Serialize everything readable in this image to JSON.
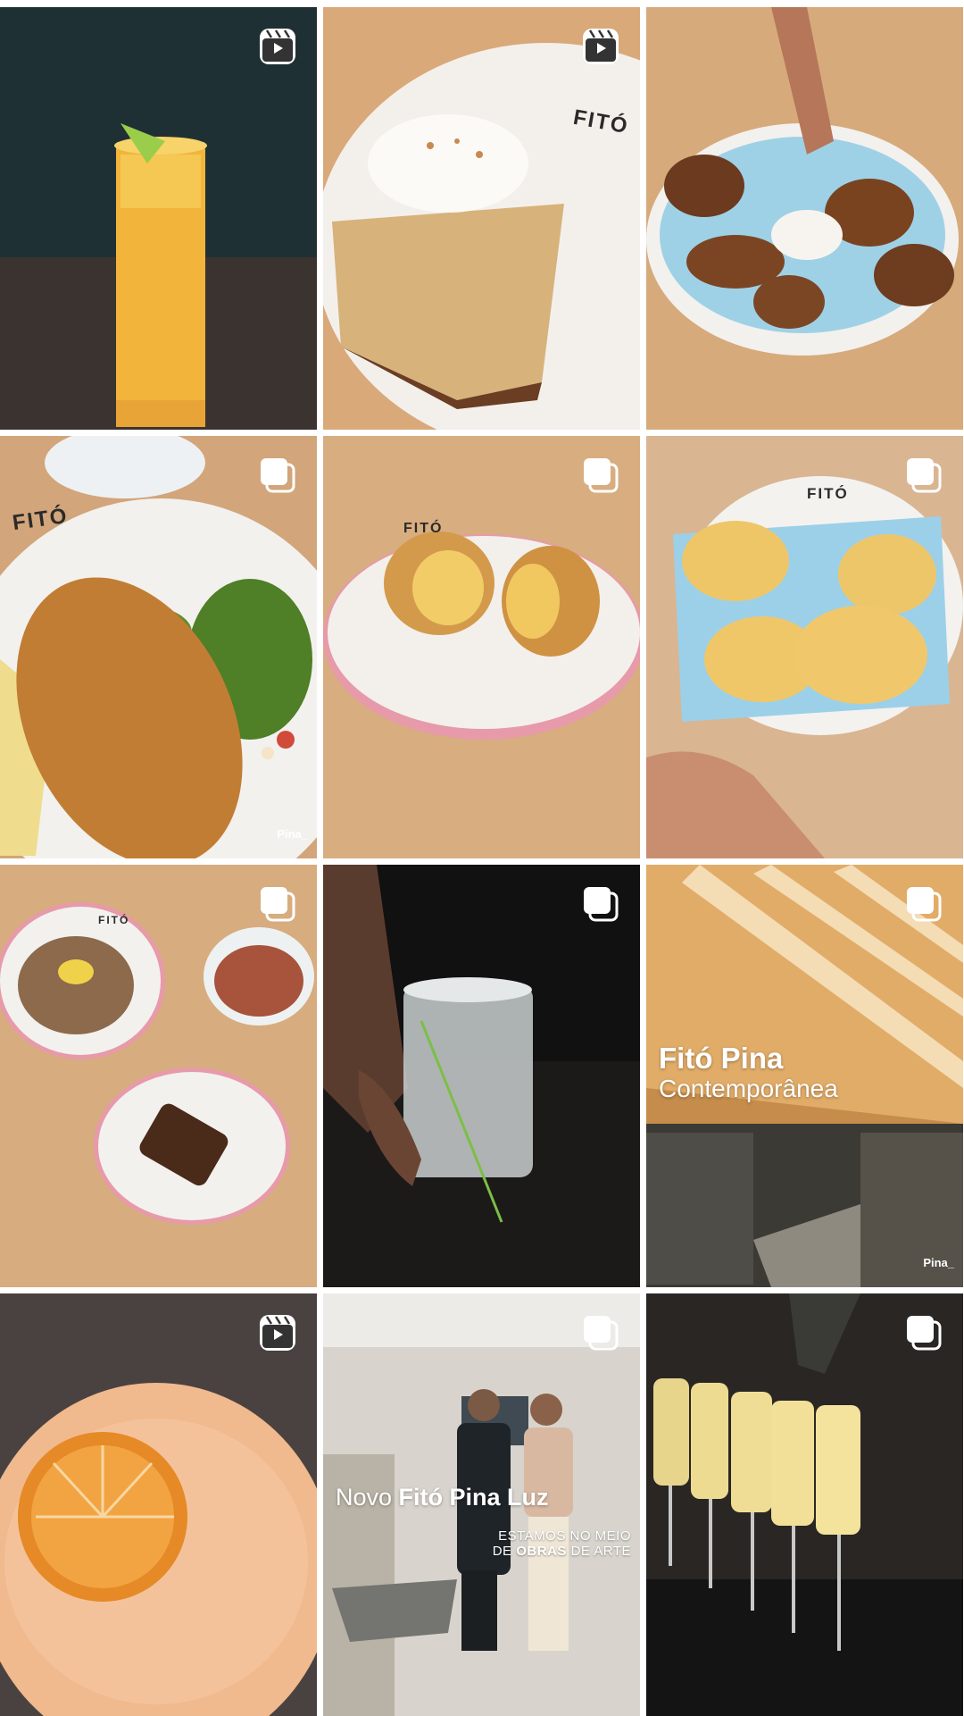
{
  "posts": [
    {
      "type": "reel",
      "badge_icon": "reel-icon"
    },
    {
      "type": "reel",
      "badge_icon": "reel-icon",
      "plate_text": "FITÓ"
    },
    {
      "type": "photo"
    },
    {
      "type": "carousel",
      "badge_icon": "carousel-icon",
      "plate_text": "FITÓ",
      "corner_mark": "Pina_"
    },
    {
      "type": "carousel",
      "badge_icon": "carousel-icon",
      "plate_text": "FITÓ"
    },
    {
      "type": "carousel",
      "badge_icon": "carousel-icon",
      "plate_text": "FITÓ"
    },
    {
      "type": "carousel",
      "badge_icon": "carousel-icon",
      "plate_text": "FITÓ"
    },
    {
      "type": "carousel",
      "badge_icon": "carousel-icon"
    },
    {
      "type": "carousel",
      "badge_icon": "carousel-icon",
      "title_bold": "Fitó Pina",
      "title_light": "Contemporânea",
      "corner_mark": "Pina_"
    },
    {
      "type": "reel",
      "badge_icon": "reel-icon"
    },
    {
      "type": "carousel",
      "badge_icon": "carousel-icon",
      "title_light": "Novo ",
      "title_bold": "Fitó Pina Luz",
      "sub_line1": "ESTAMOS NO MEIO",
      "sub_line2_a": "DE ",
      "sub_line2_b": "OBRAS",
      "sub_line2_c": " DE ARTE"
    },
    {
      "type": "carousel",
      "badge_icon": "carousel-icon"
    }
  ]
}
